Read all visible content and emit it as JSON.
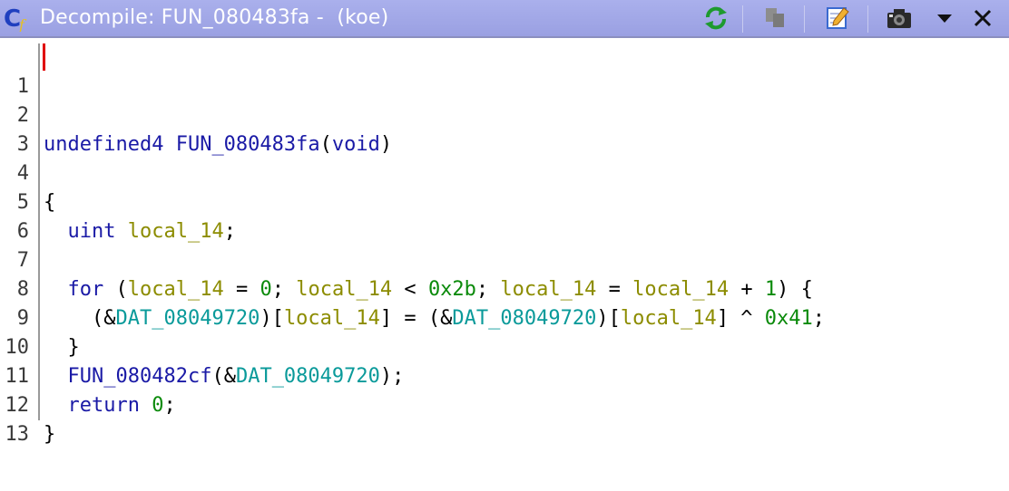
{
  "window": {
    "title": "Decompile: FUN_080483fa -  (koe)",
    "icons": [
      "decompiler-app-icon",
      "refresh-icon",
      "copy-icon",
      "edit-icon",
      "snapshot-icon",
      "dropdown-icon",
      "close-icon"
    ]
  },
  "code": {
    "line_numbers": [
      "1",
      "2",
      "3",
      "4",
      "5",
      "6",
      "7",
      "8",
      "9",
      "10",
      "11",
      "12",
      "13"
    ],
    "t": {
      "l2_type": "undefined4",
      "l2_fn": "FUN_080483fa",
      "l2_open": "(",
      "l2_void": "void",
      "l2_close": ")",
      "l4": "{",
      "l5_type": "uint",
      "l5_var": "local_14",
      "l5_semi": ";",
      "l7_for": "for",
      "l7_p1": " (",
      "l7_v1": "local_14",
      "l7_p2": " = ",
      "l7_n1": "0",
      "l7_p3": "; ",
      "l7_v2": "local_14",
      "l7_p4": " < ",
      "l7_n2": "0x2b",
      "l7_p5": "; ",
      "l7_v3": "local_14",
      "l7_p6": " = ",
      "l7_v4": "local_14",
      "l7_p7": " + ",
      "l7_n3": "1",
      "l7_p8": ") {",
      "l8_p1": "(&",
      "l8_g1": "DAT_08049720",
      "l8_p2": ")[",
      "l8_v1": "local_14",
      "l8_p3": "] = (&",
      "l8_g2": "DAT_08049720",
      "l8_p4": ")[",
      "l8_v2": "local_14",
      "l8_p5": "] ^ ",
      "l8_n1": "0x41",
      "l8_p6": ";",
      "l9": "}",
      "l10_fn": "FUN_080482cf",
      "l10_p1": "(&",
      "l10_g1": "DAT_08049720",
      "l10_p2": ");",
      "l11_kw": "return",
      "l11_sp": " ",
      "l11_n1": "0",
      "l11_p1": ";",
      "l12": "}"
    }
  },
  "colors": {
    "titlebar": "#9aa0e2",
    "keyword": "#1a1aa6",
    "variable": "#8c8c00",
    "global": "#0a9a9a",
    "number": "#0a8a0a",
    "caret": "#e00000"
  }
}
